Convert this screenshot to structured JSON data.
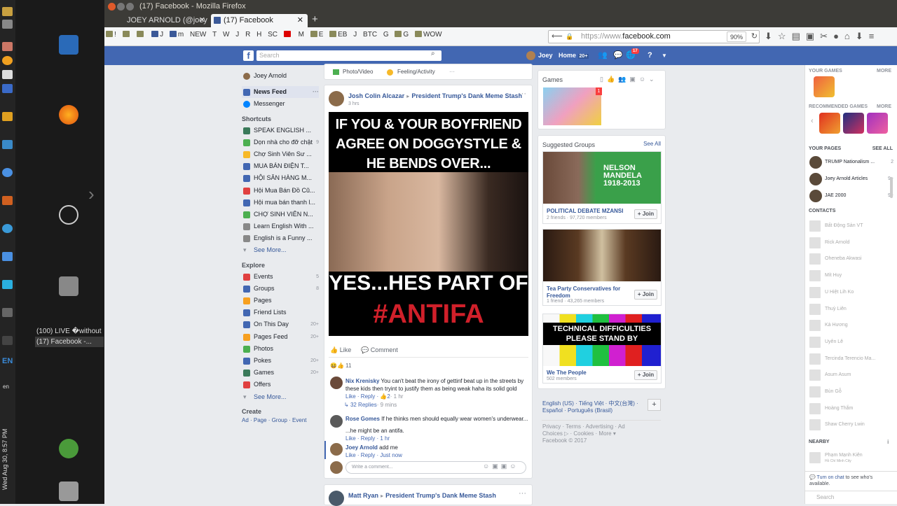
{
  "window": {
    "title": "(17) Facebook - Mozilla Firefox"
  },
  "tabs": [
    {
      "label": "JOEY ARNOLD (@joey"
    },
    {
      "label": "(17) Facebook"
    }
  ],
  "bookmarks": [
    "!",
    "",
    "",
    "J",
    "m",
    "NEW",
    "T",
    "W",
    "J",
    "R",
    "H",
    "SC",
    "",
    "M",
    "",
    "E",
    "EB",
    "J",
    "BTC",
    "G",
    "",
    "G",
    "WOW"
  ],
  "url": {
    "scheme": "https://www.",
    "host": "facebook.com",
    "zoom": "90%"
  },
  "desktop": {
    "clock": "Wed Aug 30, 8:57 PM",
    "lang": "EN",
    "lang2": "en",
    "tasks": [
      "(100) LIVE �without R...",
      "(17) Facebook -..."
    ]
  },
  "fb": {
    "search_placeholder": "Search",
    "user": "Joey",
    "home": "Home",
    "home_count": "20+",
    "notif_count": "17",
    "left": {
      "profile": "Joey Arnold",
      "main": [
        {
          "label": "News Feed"
        },
        {
          "label": "Messenger"
        }
      ],
      "shortcuts_title": "Shortcuts",
      "shortcuts": [
        {
          "label": "SPEAK ENGLISH ..."
        },
        {
          "label": "Dọn nhà cho đỡ chật",
          "count": "9"
        },
        {
          "label": "Chợ Sinh Viên Sư ..."
        },
        {
          "label": "MUA BÁN ĐIỆN T..."
        },
        {
          "label": "HỘI SĂN HÀNG M..."
        },
        {
          "label": "Hội Mua Bán Đồ Cũ..."
        },
        {
          "label": "Hội mua bán thanh l..."
        },
        {
          "label": "CHỢ SINH VIÊN N..."
        },
        {
          "label": "Learn English With ..."
        },
        {
          "label": "English is a Funny ..."
        }
      ],
      "see_more": "See More...",
      "explore_title": "Explore",
      "explore": [
        {
          "label": "Events",
          "count": "5"
        },
        {
          "label": "Groups",
          "count": "8"
        },
        {
          "label": "Pages",
          "count": ""
        },
        {
          "label": "Friend Lists",
          "count": ""
        },
        {
          "label": "On This Day",
          "count": "20+"
        },
        {
          "label": "Pages Feed",
          "count": "20+"
        },
        {
          "label": "Photos",
          "count": ""
        },
        {
          "label": "Pokes",
          "count": "20+"
        },
        {
          "label": "Games",
          "count": "20+"
        },
        {
          "label": "Offers",
          "count": ""
        }
      ],
      "see_more2": "See More...",
      "create_title": "Create",
      "create_links": "Ad · Page · Group · Event"
    },
    "composer": {
      "photo": "Photo/Video",
      "feeling": "Feeling/Activity",
      "more": "···"
    },
    "post": {
      "author": "Josh Colin Alcazar",
      "group": "President Trump's Dank Meme Stash",
      "time": "3 hrs",
      "meme_top": "IF YOU & YOUR BOYFRIEND\nAGREE ON DOGGYSTYLE &\nHE BENDS OVER...",
      "meme_bottom1": "YES...HES PART OF",
      "meme_bottom2": "#ANTIFA",
      "like": "Like",
      "comment": "Comment",
      "reactions": "11",
      "comments": [
        {
          "name": "Nix Krenisky",
          "text": "You can't beat the irony of gettinf beat up in the streets by these kids then tryint to justify them as being weak haha its solid gold",
          "meta": "Like · Reply ·",
          "likes": "2",
          "time": "· 1 hr"
        },
        {
          "replies": "32 Replies",
          "time": "· 9 mins"
        },
        {
          "name": "Rose Gomes",
          "text": "If he thinks men should equally wear women's underwear...",
          "text2": "...he might be an antifa.",
          "meta": "Like · Reply · 1 hr"
        },
        {
          "name": "Joey Arnold",
          "text": "add me",
          "meta": "Like · Reply · Just now"
        }
      ],
      "write_placeholder": "Write a comment..."
    },
    "post2": {
      "author": "Matt Ryan",
      "group": "President Trump's Dank Meme Stash"
    },
    "right": {
      "games_title": "Games",
      "games_badge": "1",
      "groups_title": "Suggested Groups",
      "see_all": "See All",
      "groups": [
        {
          "name": "POLITICAL DEBATE MZANSI",
          "members": "2 friends · 97,720 members",
          "img_text": "NELSON\nMANDELA\n1918-2013"
        },
        {
          "name": "Tea Party Conservatives for Freedom",
          "members": "1 friend · 43,265 members"
        },
        {
          "name": "We The People",
          "members": "502 members",
          "img_text": "TECHNICAL DIFFICULTIES\nPLEASE STAND BY"
        }
      ],
      "join": "+ Join",
      "languages": "English (US) · Tiếng Việt · 中文(台灣) · Español · Português (Brasil)",
      "footer": "Privacy · Terms · Advertising · Ad Choices ▷ · Cookies · More ▾",
      "copyright": "Facebook © 2017"
    },
    "chat": {
      "your_games": "YOUR GAMES",
      "more": "MORE",
      "recommended": "RECOMMENDED GAMES",
      "more2": "MORE",
      "your_pages": "YOUR PAGES",
      "see_all": "SEE ALL",
      "pages": [
        {
          "name": "TRUMP Nationalism ...",
          "count": "2"
        },
        {
          "name": "Joey Arnold Articles",
          "count": "9+"
        },
        {
          "name": "JAE 2000",
          "count": "9+"
        }
      ],
      "contacts_title": "CONTACTS",
      "contacts": [
        "Bất Động Sản VT",
        "Rick Arnold",
        "Oheneba Akwasi",
        "Mít Huy",
        "U Hiệt Lih Ko",
        "Thuỳ Liên",
        "Kà Hương",
        "Uyên Lê",
        "Tercinda Terencio Ma...",
        "Asum Asum",
        "Bùn Gỗ",
        "Hoàng Thắm",
        "Shaw Cherry Lwin"
      ],
      "nearby": "NEARBY",
      "nearby_person": "Phạm Mạnh Kiên",
      "nearby_sub": "Hồ Chí Minh City",
      "turn_on": "Turn on chat",
      "turn_on_rest": "to see who's available.",
      "search": "Search"
    }
  }
}
